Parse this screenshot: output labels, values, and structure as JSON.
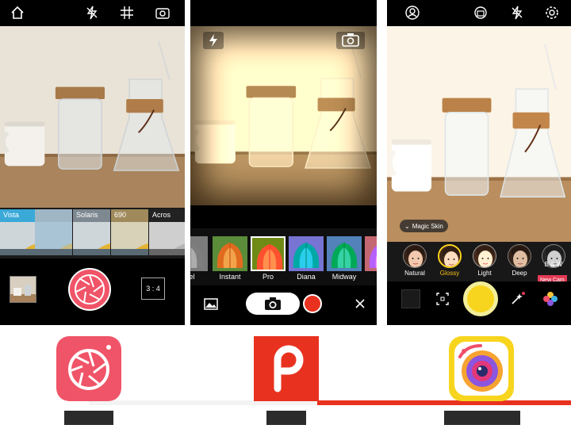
{
  "colors": {
    "pomelo_pink": "#f05468",
    "picsart_red": "#e8321f",
    "camera360_yellow": "#f7d51e",
    "selected_gold": "#f7c21a"
  },
  "phone1": {
    "top_icons": [
      "home-icon",
      "flash-off-icon",
      "grid-icon",
      "switch-camera-icon"
    ],
    "filters": [
      {
        "label": "Vista",
        "color": "#3aa9d8"
      },
      {
        "label": "",
        "color": "#9fb6c4"
      },
      {
        "label": "Solaris",
        "color": "#7e8890"
      },
      {
        "label": "690",
        "color": "#a08a5c"
      },
      {
        "label": "Acros",
        "color": "#222222"
      }
    ],
    "aspect_ratio": "3 : 4"
  },
  "phone2": {
    "top_icons": [
      "flash-icon",
      "switch-camera-icon"
    ],
    "filters": [
      {
        "label": "el"
      },
      {
        "label": "Instant"
      },
      {
        "label": "Pro",
        "selected": true
      },
      {
        "label": "Diana"
      },
      {
        "label": "Midway"
      }
    ]
  },
  "phone3": {
    "top_icons": [
      "profile-icon",
      "settings-camera-icon",
      "flash-off-icon",
      "gear-icon"
    ],
    "magic_skin": "Magic Skin",
    "skin_modes": [
      {
        "label": "Natural"
      },
      {
        "label": "Glossy",
        "selected": true
      },
      {
        "label": "Light"
      },
      {
        "label": "Deep"
      },
      {
        "label": "B & W"
      }
    ],
    "new_cam_badge": "New Cam"
  },
  "apps": [
    {
      "name": "",
      "icon": "pomelo-logo"
    },
    {
      "name": "",
      "icon": "picsart-logo"
    },
    {
      "name": "",
      "icon": "camera360-logo"
    }
  ]
}
